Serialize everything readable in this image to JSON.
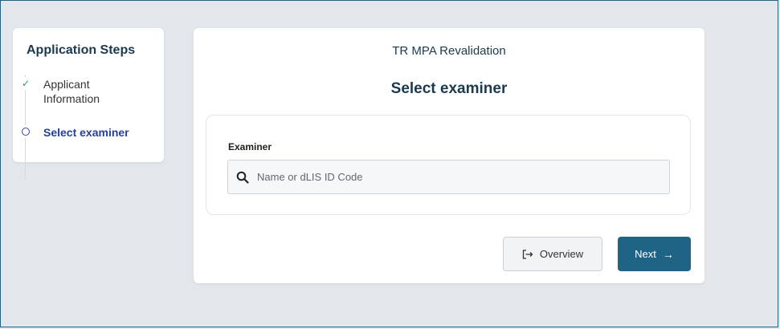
{
  "steps_panel": {
    "title": "Application Steps",
    "items": [
      {
        "label": "Applicant Information",
        "status": "completed",
        "icon": "check-icon"
      },
      {
        "label": "Select examiner",
        "status": "active",
        "icon": "circle-icon"
      }
    ]
  },
  "main": {
    "app_title": "TR MPA Revalidation",
    "page_title": "Select examiner",
    "examiner": {
      "label": "Examiner",
      "search_placeholder": "Name or dLIS ID Code",
      "search_value": ""
    },
    "buttons": {
      "overview_label": "Overview",
      "overview_icon": "exit-icon",
      "next_label": "Next",
      "next_icon": "arrow-right-icon"
    }
  },
  "colors": {
    "accent": "#1f6385",
    "active_step": "#25409a",
    "completed_check": "#1e9e6e",
    "page_background": "#e2e7ec"
  }
}
